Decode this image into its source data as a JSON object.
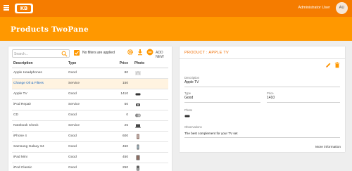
{
  "topbar": {
    "user_name": "Administrator User",
    "avatar_initials": "AU",
    "logo_text": "KB",
    "accent": "#f57c00"
  },
  "page": {
    "title": "Products TwoPane",
    "title_bar_color": "#ff9800"
  },
  "list_panel": {
    "search_placeholder": "Search...",
    "filter_label": "No filters are applied",
    "add_label": "ADD NEW",
    "columns": [
      "Description",
      "Type",
      "Price",
      "Photo"
    ],
    "rows": [
      {
        "description": "Apple Headphones",
        "type": "Good",
        "price": "80",
        "photo": "headphones-thumbnail"
      },
      {
        "description": "Change Oil & Filters",
        "type": "Service",
        "price": "150",
        "photo": "none"
      },
      {
        "description": "Apple TV",
        "type": "Good",
        "price": "1410",
        "photo": "apple-tv-thumbnail"
      },
      {
        "description": "iPod Repair",
        "type": "Service",
        "price": "50",
        "photo": "ipod-thumbnail"
      },
      {
        "description": "CD",
        "type": "Good",
        "price": "0",
        "photo": "cd-thumbnail"
      },
      {
        "description": "Notebook Check",
        "type": "Service",
        "price": "25",
        "photo": "notebook-thumbnail"
      },
      {
        "description": "iPhone 4",
        "type": "Good",
        "price": "600",
        "photo": "iphone-thumbnail"
      },
      {
        "description": "Samsung Galaxy S4",
        "type": "Good",
        "price": "450",
        "photo": "galaxy-thumbnail"
      },
      {
        "description": "iPad Mini",
        "type": "Good",
        "price": "450",
        "photo": "ipad-mini-thumbnail"
      },
      {
        "description": "iPod Classic",
        "type": "Good",
        "price": "250",
        "photo": "ipod-classic-thumbnail"
      }
    ],
    "selected_index": 1
  },
  "detail_panel": {
    "title": "PRODUCT : APPLE TV",
    "description_label": "Description",
    "description_value": "Apple TV",
    "type_label": "Type",
    "type_value": "Good",
    "price_label": "Price",
    "price_value": "1410",
    "photo_label": "Photo",
    "observations_label": "Observations",
    "observations_value": "The best complement for your TV set",
    "more_info": "More information"
  }
}
